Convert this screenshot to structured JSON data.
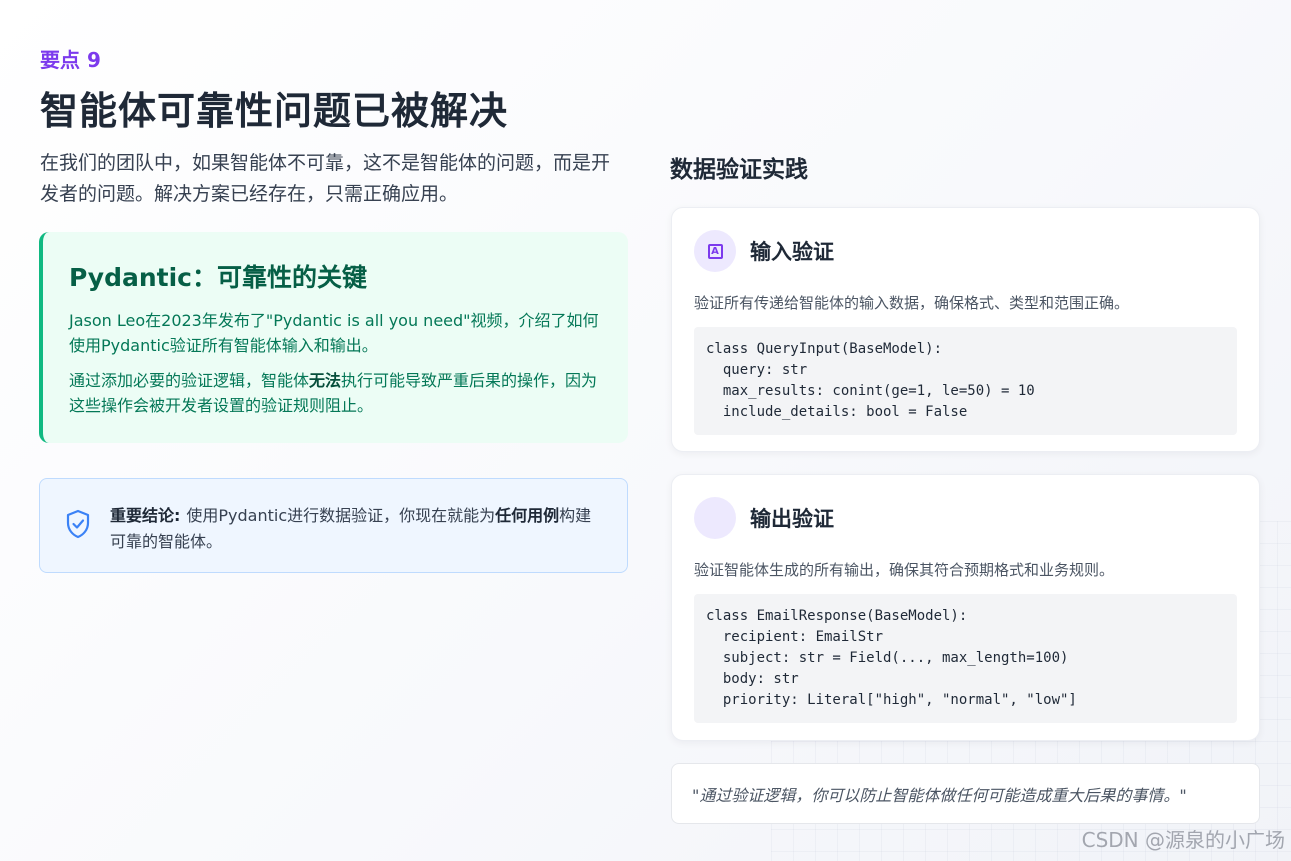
{
  "eyebrow": "要点 9",
  "title": "智能体可靠性问题已被解决",
  "intro": "在我们的团队中，如果智能体不可靠，这不是智能体的问题，而是开发者的问题。解决方案已经存在，只需正确应用。",
  "highlight": {
    "title": "Pydantic：可靠性的关键",
    "p1": "Jason Leo在2023年发布了\"Pydantic is all you need\"视频，介绍了如何使用Pydantic验证所有智能体输入和输出。",
    "p2_before": "通过添加必要的验证逻辑，智能体",
    "p2_bold": "无法",
    "p2_after": "执行可能导致严重后果的操作，因为这些操作会被开发者设置的验证规则阻止。"
  },
  "conclusion": {
    "label": "重要结论:",
    "text_before": "使用Pydantic进行数据验证，你现在就能为",
    "text_bold": "任何用例",
    "text_after": "构建可靠的智能体。",
    "icon": "shield-check-icon"
  },
  "section_title": "数据验证实践",
  "cards": [
    {
      "title": "输入验证",
      "icon": "input-icon",
      "desc": "验证所有传递给智能体的输入数据，确保格式、类型和范围正确。",
      "code": "class QueryInput(BaseModel):\n  query: str\n  max_results: conint(ge=1, le=50) = 10\n  include_details: bool = False"
    },
    {
      "title": "输出验证",
      "icon": "output-icon",
      "desc": "验证智能体生成的所有输出，确保其符合预期格式和业务规则。",
      "code": "class EmailResponse(BaseModel):\n  recipient: EmailStr\n  subject: str = Field(..., max_length=100)\n  body: str\n  priority: Literal[\"high\", \"normal\", \"low\"]"
    }
  ],
  "quote": "\"通过验证逻辑，你可以防止智能体做任何可能造成重大后果的事情。\"",
  "watermark": "CSDN @源泉的小广场",
  "colors": {
    "accent": "#7c3aed",
    "green": "#10b981",
    "green_bg": "#ecfdf5",
    "blue_bg": "#eff6ff",
    "blue_icon": "#3b82f6"
  }
}
